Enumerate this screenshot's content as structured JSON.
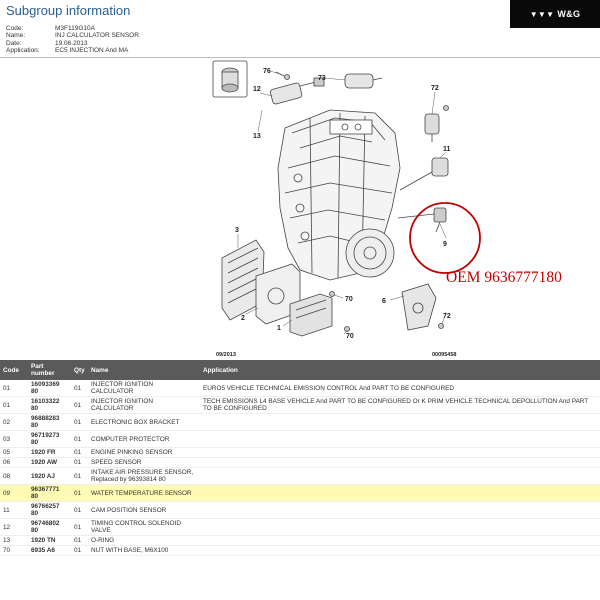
{
  "header": {
    "title": "Subgroup information",
    "meta": [
      {
        "key": "Code:",
        "value": "M3F119G10A"
      },
      {
        "key": "Name:",
        "value": "INJ CALCULATOR SENSOR"
      },
      {
        "key": "Date:",
        "value": "19.06.2013"
      },
      {
        "key": "Application:",
        "value": "EC5 INJECTION And MA"
      }
    ],
    "brand": "W&G",
    "brand_mark": "▼▼▼",
    "brand_bg": "#0a0a0a"
  },
  "diagram": {
    "date_code": "09/2013",
    "ref_code": "00095458",
    "oem_label": "OEM 9636777180",
    "highlight_color": "#c00000",
    "callouts": [
      "76",
      "12",
      "13",
      "73",
      "72",
      "11",
      "9",
      "3",
      "2",
      "1",
      "70",
      "6",
      "72",
      "70"
    ]
  },
  "table": {
    "columns": [
      "Code",
      "Part number",
      "Qty",
      "Name",
      "Application"
    ],
    "highlight_color": "#fffbb4",
    "header_color": "#5a5a5a",
    "rows": [
      {
        "code": "01",
        "part": "16093369 80",
        "qty": "01",
        "name": "INJECTOR IGNITION CALCULATOR",
        "application": "EURO5 VEHICLE TECHNICAL EMISSION CONTROL And PART TO BE CONFIGURED",
        "highlight": false
      },
      {
        "code": "01",
        "part": "16103322 80",
        "qty": "01",
        "name": "INJECTOR IGNITION CALCULATOR",
        "application": "TECH EMISSIONS L4 BASE VEHICLE And PART TO BE CONFIGURED Or K PRIM VEHICLE TECHNICAL DEPOLLUTION And PART TO BE CONFIGURED",
        "highlight": false
      },
      {
        "code": "02",
        "part": "96888283 80",
        "qty": "01",
        "name": "ELECTRONIC BOX BRACKET",
        "application": "",
        "highlight": false
      },
      {
        "code": "03",
        "part": "96719273 80",
        "qty": "01",
        "name": "COMPUTER PROTECTOR",
        "application": "",
        "highlight": false
      },
      {
        "code": "05",
        "part": "1920 FR",
        "qty": "01",
        "name": "ENGINE PINKING SENSOR",
        "application": "",
        "highlight": false
      },
      {
        "code": "06",
        "part": "1920 AW",
        "qty": "01",
        "name": "SPEED SENSOR",
        "application": "",
        "highlight": false
      },
      {
        "code": "08",
        "part": "1920 AJ",
        "qty": "01",
        "name": "INTAKE AIR PRESSURE SENSOR, Replaced by 96393814 80",
        "application": "",
        "highlight": false
      },
      {
        "code": "09",
        "part": "96367771 80",
        "qty": "01",
        "name": "WATER TEMPERATURE SENSOR",
        "application": "",
        "highlight": true
      },
      {
        "code": "11",
        "part": "96766257 80",
        "qty": "01",
        "name": "CAM POSITION SENSOR",
        "application": "",
        "highlight": false
      },
      {
        "code": "12",
        "part": "96746802 80",
        "qty": "01",
        "name": "TIMING CONTROL SOLENOID VALVE",
        "application": "",
        "highlight": false
      },
      {
        "code": "13",
        "part": "1920 TN",
        "qty": "01",
        "name": "O-RING",
        "application": "",
        "highlight": false
      },
      {
        "code": "70",
        "part": "6935 A6",
        "qty": "01",
        "name": "NUT WITH BASE, M6X100",
        "application": "",
        "highlight": false
      }
    ]
  }
}
